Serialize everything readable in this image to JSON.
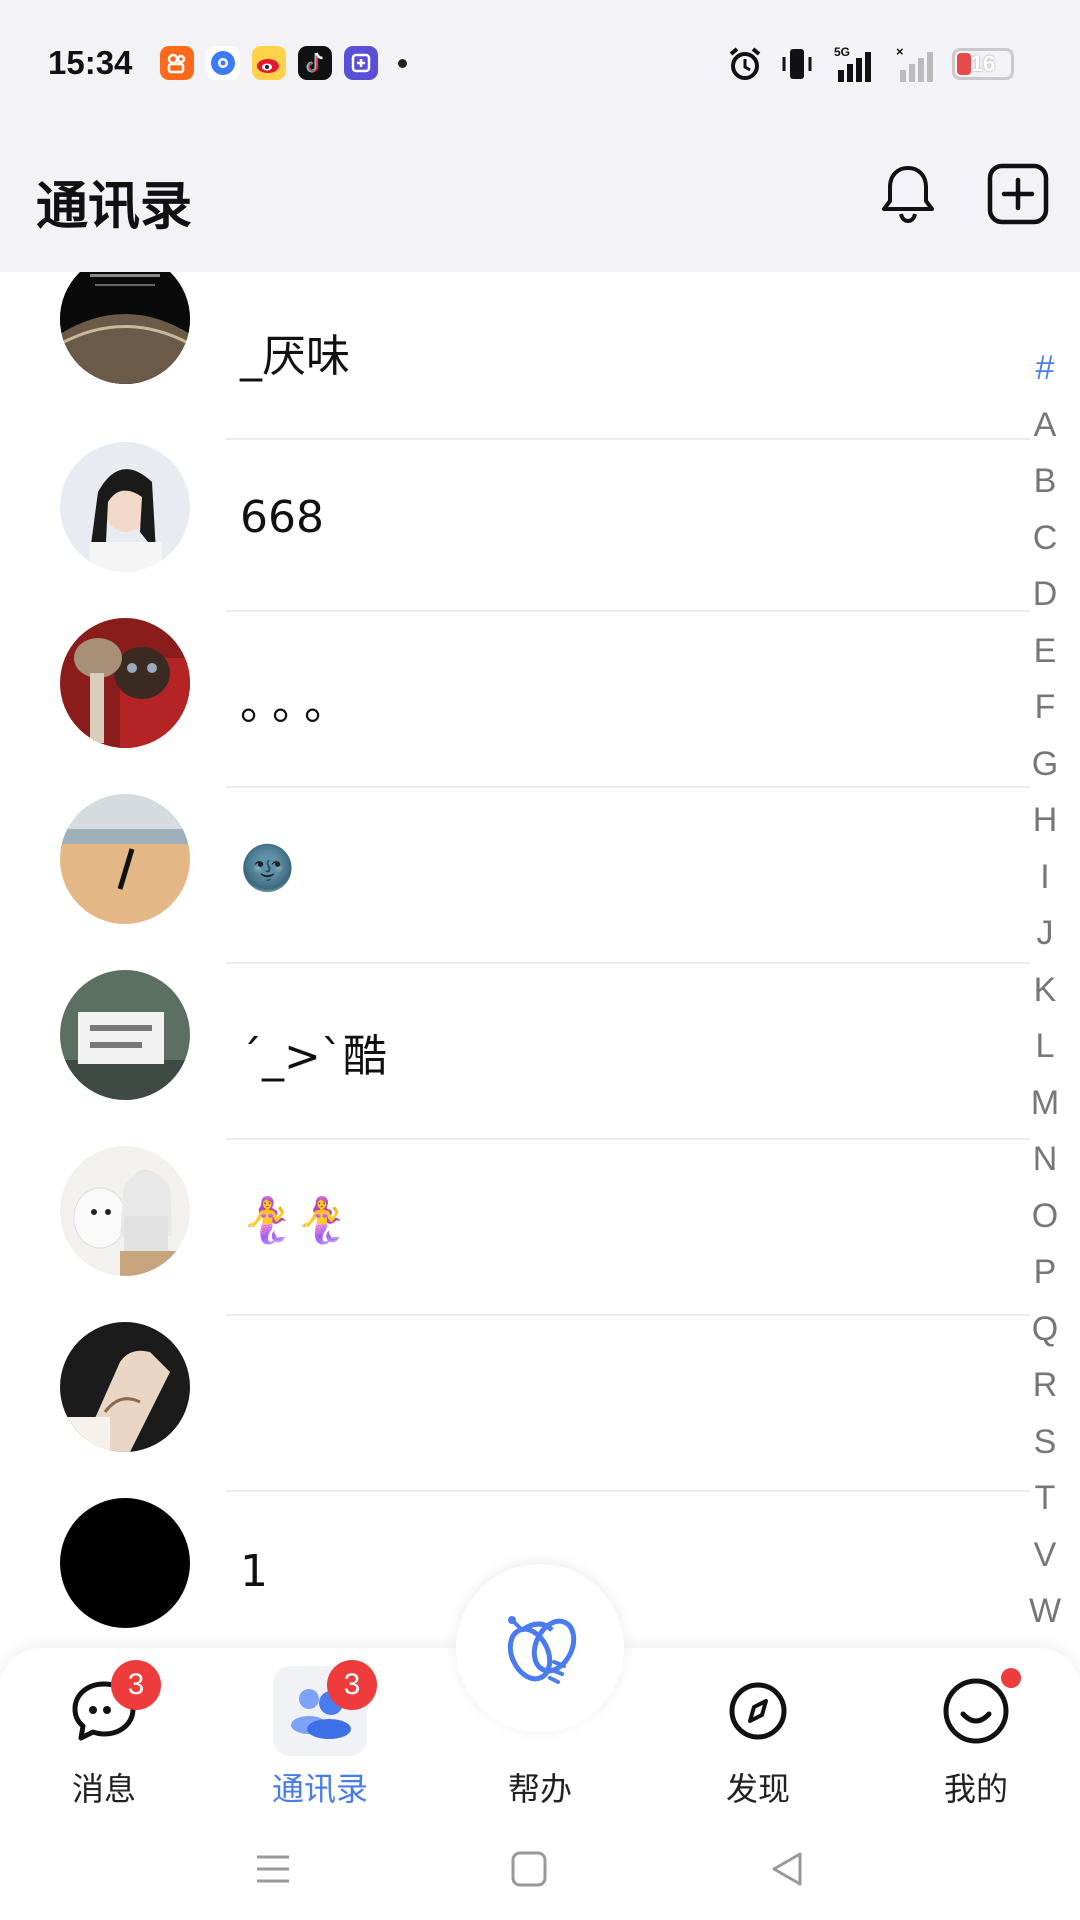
{
  "status_bar": {
    "time": "15:34",
    "battery": "16",
    "network": "5G",
    "app_icons": [
      "kuaishou-icon",
      "qq-browser-icon",
      "weibo-icon",
      "douyin-icon",
      "tieba-icon"
    ]
  },
  "header": {
    "title": "通讯录",
    "actions": [
      "bell-icon",
      "add-icon"
    ]
  },
  "contacts": [
    {
      "name": "_厌味"
    },
    {
      "name": "668"
    },
    {
      "name": "。。。"
    },
    {
      "name": "🌚"
    },
    {
      "name": "´_>`酷"
    },
    {
      "name": "🧜‍♀️🧜‍♀️"
    },
    {
      "name": ""
    },
    {
      "name": "1"
    }
  ],
  "index_letters": [
    "#",
    "A",
    "B",
    "C",
    "D",
    "E",
    "F",
    "G",
    "H",
    "I",
    "J",
    "K",
    "L",
    "M",
    "N",
    "O",
    "P",
    "Q",
    "R",
    "S",
    "T",
    "V",
    "W"
  ],
  "tabbar": {
    "messages": {
      "label": "消息",
      "badge": "3"
    },
    "contacts": {
      "label": "通讯录",
      "badge": "3"
    },
    "help": {
      "label": "帮办"
    },
    "discover": {
      "label": "发现"
    },
    "me": {
      "label": "我的"
    }
  },
  "colors": {
    "accent": "#4a7cf0",
    "badge": "#ee3b3b",
    "header_bg": "#f2f2f7"
  }
}
